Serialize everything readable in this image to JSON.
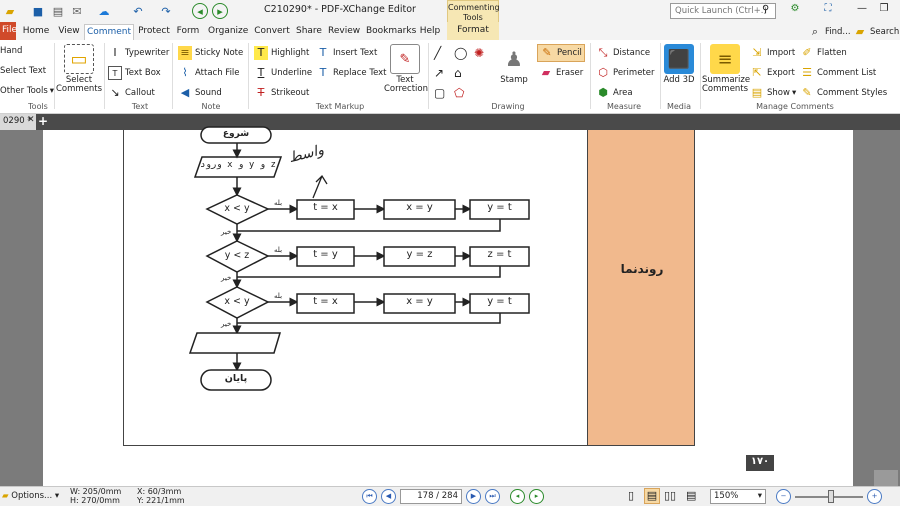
{
  "titlebar": {
    "title": "C210290* - PDF-XChange Editor",
    "context_group": "Commenting Tools",
    "quick_launch_placeholder": "Quick Launch (Ctrl+.)"
  },
  "tabs": [
    {
      "label": "File"
    },
    {
      "label": "Home"
    },
    {
      "label": "View"
    },
    {
      "label": "Comment"
    },
    {
      "label": "Protect"
    },
    {
      "label": "Form"
    },
    {
      "label": "Organize"
    },
    {
      "label": "Convert"
    },
    {
      "label": "Share"
    },
    {
      "label": "Review"
    },
    {
      "label": "Bookmarks"
    },
    {
      "label": "Help"
    },
    {
      "label": "Format"
    }
  ],
  "tabs_right": {
    "find": "Find...",
    "search": "Search..."
  },
  "ribbon": {
    "tools": {
      "hand": "Hand",
      "select_text": "Select Text",
      "other_tools": "Other Tools",
      "label": "Tools"
    },
    "select_comments": "Select Comments",
    "text": {
      "typewriter": "Typewriter",
      "text_box": "Text Box",
      "callout": "Callout",
      "label": "Text"
    },
    "note": {
      "sticky_note": "Sticky Note",
      "attach_file": "Attach File",
      "sound": "Sound",
      "label": "Note"
    },
    "markup": {
      "highlight": "Highlight",
      "insert_text": "Insert Text",
      "underline": "Underline",
      "replace_text": "Replace Text",
      "strikeout": "Strikeout",
      "text_correction": "Text Correction",
      "label": "Text Markup"
    },
    "drawing": {
      "stamp": "Stamp",
      "pencil": "Pencil",
      "eraser": "Eraser",
      "label": "Drawing"
    },
    "measure": {
      "distance": "Distance",
      "perimeter": "Perimeter",
      "area": "Area",
      "label": "Measure"
    },
    "media": {
      "add_3d": "Add 3D",
      "label": "Media"
    },
    "manage": {
      "summarize": "Summarize Comments",
      "import": "Import",
      "export": "Export",
      "show": "Show",
      "flatten": "Flatten",
      "comment_list": "Comment List",
      "comment_styles": "Comment Styles",
      "label": "Manage Comments"
    }
  },
  "document": {
    "tab_label": "0290 *",
    "side_label": "روندنما",
    "page_number": "۱۷۰",
    "flow": {
      "start": "شروع",
      "input": "ورود x و y و z",
      "cond1": "x < y",
      "cond2": "y < z",
      "cond3": "x < y",
      "yes": "بله",
      "no": "خیر",
      "row1": [
        "t = x",
        "x = y",
        "y = t"
      ],
      "row2": [
        "t = y",
        "y = z",
        "z = t"
      ],
      "row3": [
        "t = x",
        "x = y",
        "y = t"
      ],
      "end": "پایان",
      "annotation": "واسط"
    }
  },
  "status": {
    "options": "Options...",
    "width": "W: 205/0mm",
    "height": "H: 270/0mm",
    "x": "X: 60/3mm",
    "y": "Y: 221/1mm",
    "page_current": "178",
    "page_total": "284",
    "zoom": "150%"
  }
}
